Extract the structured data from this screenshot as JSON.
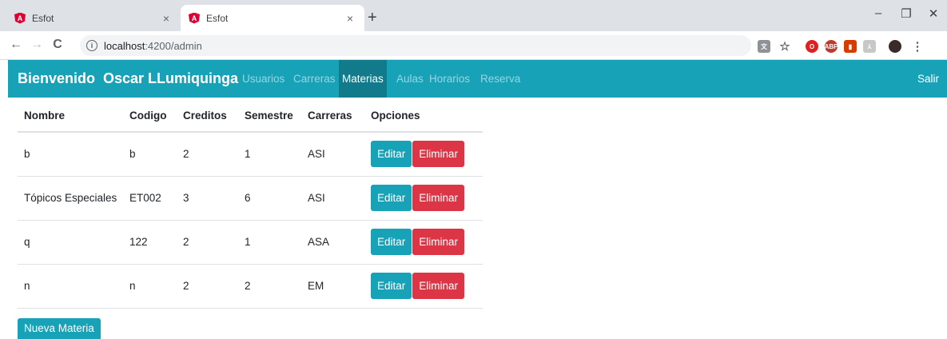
{
  "browser": {
    "tabs": [
      {
        "title": "Esfot",
        "close": "×"
      },
      {
        "title": "Esfot",
        "close": "×"
      }
    ],
    "new_tab": "+",
    "window_controls": {
      "minimize": "–",
      "maximize": "❐",
      "close": "✕"
    },
    "nav": {
      "back": "←",
      "forward": "→",
      "reload": "C"
    },
    "address": {
      "host": "localhost",
      "path": ":4200/admin"
    }
  },
  "navbar": {
    "brand": "Bienvenido  Oscar LLumiquinga",
    "links": [
      "Usuarios",
      "Carreras",
      "Materias",
      "Aulas",
      "Horarios",
      "Reserva"
    ],
    "active_link": "Materias",
    "logout": "Salir"
  },
  "table": {
    "headers": [
      "Nombre",
      "Codigo",
      "Creditos",
      "Semestre",
      "Carreras",
      "Opciones"
    ],
    "rows": [
      [
        "b",
        "b",
        "2",
        "1",
        "ASI"
      ],
      [
        "Tópicos Especiales",
        "ET002",
        "3",
        "6",
        "ASI"
      ],
      [
        "q",
        "122",
        "2",
        "1",
        "ASA"
      ],
      [
        "n",
        "n",
        "2",
        "2",
        "EM"
      ]
    ],
    "edit_label": "Editar",
    "delete_label": "Eliminar"
  },
  "new_button": "Nueva Materia",
  "colors": {
    "accent": "#17a2b8",
    "accent_active": "#117a8b",
    "danger": "#dc3545"
  },
  "icons": {
    "favicon": "angular-icon",
    "info": "info-icon",
    "star": "star-icon",
    "translate": "translate-icon",
    "menu": "kebab-menu-icon"
  }
}
